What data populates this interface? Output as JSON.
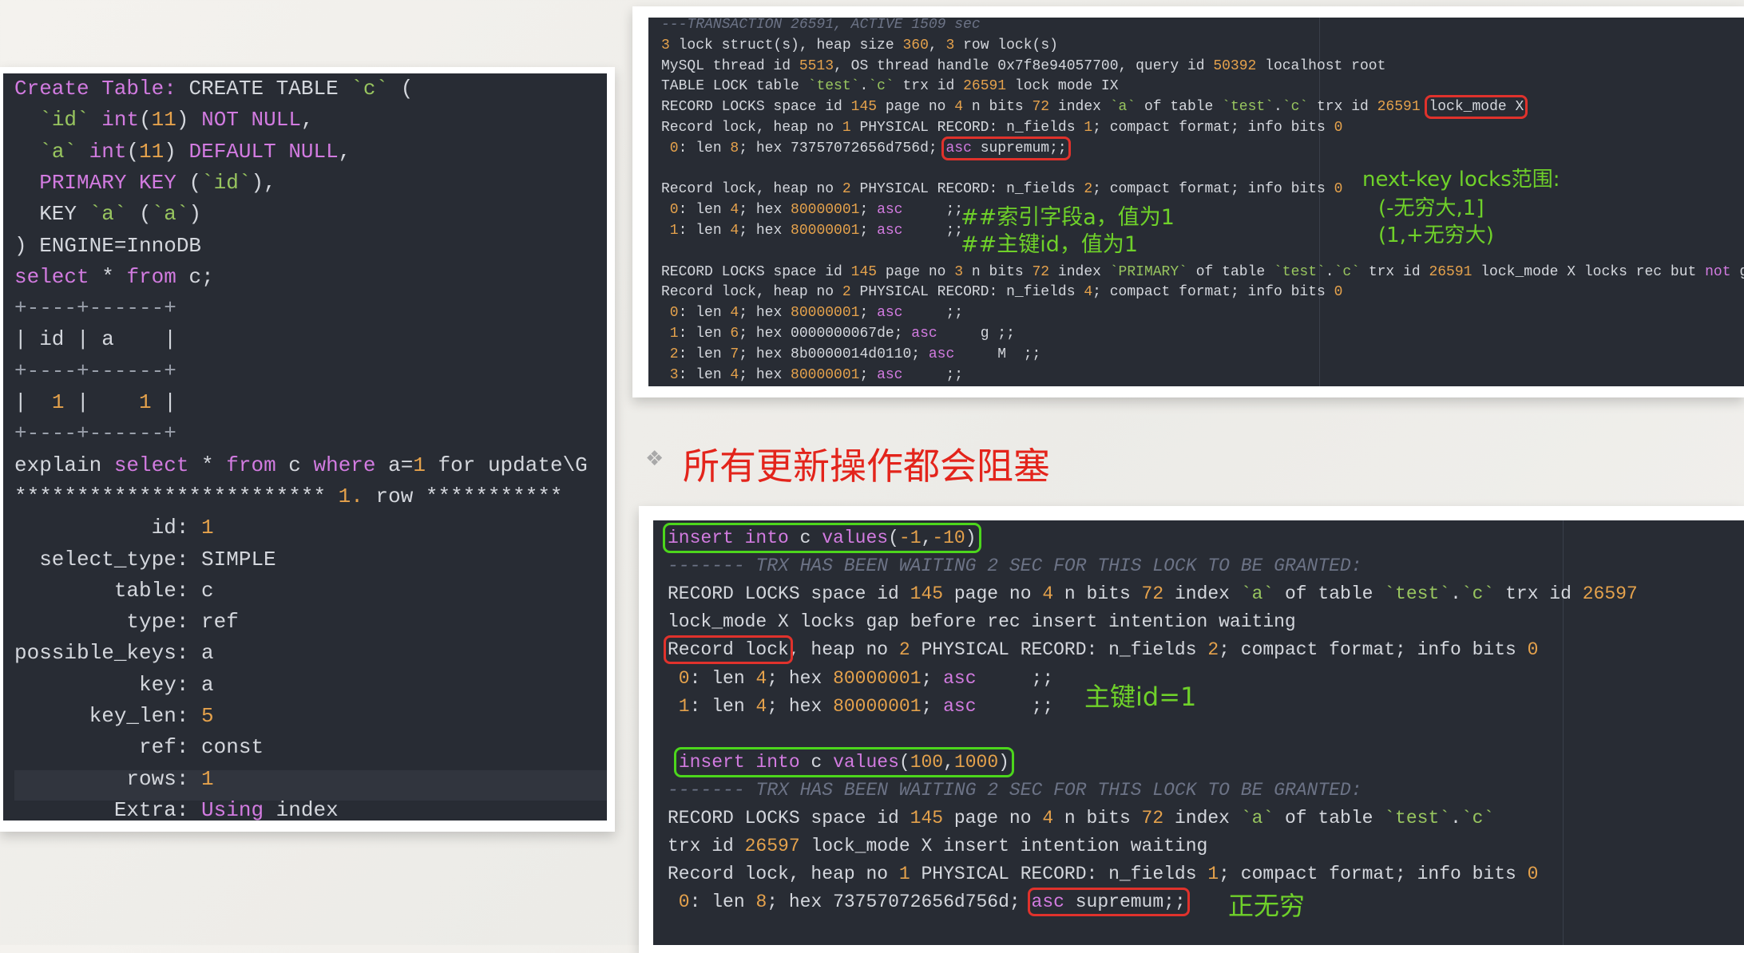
{
  "colors": {
    "keyword": "#d27be0",
    "number": "#e5a24c",
    "string": "#98c55f",
    "text": "#d4d7dd",
    "comment": "#6c7386",
    "highlight_red": "#e0322c",
    "highlight_green": "#4cd61c",
    "annotation": "#6fd12a",
    "title": "#e3241b",
    "terminal_bg": "#282c34"
  },
  "title": {
    "bullet_icon": "diamond-bullet-icon",
    "bullet": "❖",
    "text": "所有更新操作都会阻塞"
  },
  "left_panel": {
    "lines": [
      [
        [
          "Create Table:",
          "k"
        ],
        [
          " CREATE TABLE ",
          "w"
        ],
        [
          "`c`",
          "s"
        ],
        [
          " (",
          "w"
        ]
      ],
      [
        [
          "  ",
          "w"
        ],
        [
          "`id`",
          "s"
        ],
        [
          " ",
          "w"
        ],
        [
          "int",
          "k"
        ],
        [
          "(",
          "w"
        ],
        [
          "11",
          "n"
        ],
        [
          ") ",
          "w"
        ],
        [
          "NOT NULL",
          "k"
        ],
        [
          ",",
          "w"
        ]
      ],
      [
        [
          "  ",
          "w"
        ],
        [
          "`a`",
          "s"
        ],
        [
          " ",
          "w"
        ],
        [
          "int",
          "k"
        ],
        [
          "(",
          "w"
        ],
        [
          "11",
          "n"
        ],
        [
          ") ",
          "w"
        ],
        [
          "DEFAULT NULL",
          "k"
        ],
        [
          ",",
          "w"
        ]
      ],
      [
        [
          "  ",
          "w"
        ],
        [
          "PRIMARY KEY",
          "k"
        ],
        [
          " (",
          "w"
        ],
        [
          "`id`",
          "s"
        ],
        [
          "),",
          "w"
        ]
      ],
      [
        [
          "  KEY ",
          "w"
        ],
        [
          "`a`",
          "s"
        ],
        [
          " (",
          "w"
        ],
        [
          "`a`",
          "s"
        ],
        [
          ")",
          "w"
        ]
      ],
      [
        [
          ") ENGINE=InnoDB",
          "w"
        ]
      ],
      [
        [
          "select",
          "k"
        ],
        [
          " * ",
          "w"
        ],
        [
          "from",
          "k"
        ],
        [
          " c;",
          "w"
        ]
      ],
      [
        [
          "+----+------+",
          "d"
        ]
      ],
      [
        [
          "| id | a    |",
          "w"
        ]
      ],
      [
        [
          "+----+------+",
          "d"
        ]
      ],
      [
        [
          "|  ",
          "w"
        ],
        [
          "1",
          "n"
        ],
        [
          " |    ",
          "w"
        ],
        [
          "1",
          "n"
        ],
        [
          " |",
          "w"
        ]
      ],
      [
        [
          "+----+------+",
          "d"
        ]
      ],
      [
        [
          "explain ",
          "w"
        ],
        [
          "select",
          "k"
        ],
        [
          " * ",
          "w"
        ],
        [
          "from",
          "k"
        ],
        [
          " c ",
          "w"
        ],
        [
          "where",
          "k"
        ],
        [
          " a=",
          "w"
        ],
        [
          "1",
          "n"
        ],
        [
          " for update\\G",
          "w"
        ]
      ],
      [
        [
          "************************* ",
          "w"
        ],
        [
          "1.",
          "n"
        ],
        [
          " row ***********",
          "w"
        ]
      ],
      [
        [
          "           id: ",
          "w"
        ],
        [
          "1",
          "n"
        ]
      ],
      [
        [
          "  select_type: SIMPLE",
          "w"
        ]
      ],
      [
        [
          "        table: c",
          "w"
        ]
      ],
      [
        [
          "         type: ref",
          "w"
        ]
      ],
      [
        [
          "possible_keys: a",
          "w"
        ]
      ],
      [
        [
          "          key: a",
          "w"
        ]
      ],
      [
        [
          "      key_len: ",
          "w"
        ],
        [
          "5",
          "n"
        ]
      ],
      [
        [
          "          ref: const",
          "w"
        ]
      ],
      [
        [
          "         rows: ",
          "w"
        ],
        [
          "1",
          "n"
        ]
      ],
      [
        [
          "        Extra: ",
          "w"
        ],
        [
          "Using",
          "k"
        ],
        [
          " index",
          "w"
        ]
      ]
    ]
  },
  "top_right_panel": {
    "lines": [
      [
        [
          "---TRANSACTION 26591, ACTIVE 1509 sec",
          "c"
        ]
      ],
      [
        [
          "3",
          "n"
        ],
        [
          " lock struct(s), heap size ",
          "w"
        ],
        [
          "360",
          "n"
        ],
        [
          ", ",
          "w"
        ],
        [
          "3",
          "n"
        ],
        [
          " row lock(s)",
          "w"
        ]
      ],
      [
        [
          "MySQL thread id ",
          "w"
        ],
        [
          "5513",
          "n"
        ],
        [
          ", OS thread handle 0x7f8e94057700, query id ",
          "w"
        ],
        [
          "50392",
          "n"
        ],
        [
          " localhost root",
          "w"
        ]
      ],
      [
        [
          "TABLE LOCK table ",
          "w"
        ],
        [
          "`test`",
          "s"
        ],
        [
          ".",
          "w"
        ],
        [
          "`c`",
          "s"
        ],
        [
          " trx id ",
          "w"
        ],
        [
          "26591",
          "n"
        ],
        [
          " lock mode IX",
          "w"
        ]
      ],
      [
        [
          "RECORD LOCKS space id ",
          "w"
        ],
        [
          "145",
          "n"
        ],
        [
          " page no ",
          "w"
        ],
        [
          "4",
          "n"
        ],
        [
          " n bits ",
          "w"
        ],
        [
          "72",
          "n"
        ],
        [
          " index ",
          "w"
        ],
        [
          "`a`",
          "s"
        ],
        [
          " of table ",
          "w"
        ],
        [
          "`test`",
          "s"
        ],
        [
          ".",
          "w"
        ],
        [
          "`c`",
          "s"
        ],
        [
          " trx id ",
          "w"
        ],
        [
          "26591",
          "n"
        ],
        [
          " ",
          "w"
        ],
        {
          "box": "red",
          "t": [
            [
              "lock_mode X",
              "w"
            ]
          ]
        }
      ],
      [
        [
          "Record lock, heap no ",
          "w"
        ],
        [
          "1",
          "n"
        ],
        [
          " PHYSICAL RECORD: n_fields ",
          "w"
        ],
        [
          "1",
          "n"
        ],
        [
          "; compact format; info bits ",
          "w"
        ],
        [
          "0",
          "n"
        ]
      ],
      [
        [
          " 0",
          "n"
        ],
        [
          ": len ",
          "w"
        ],
        [
          "8",
          "n"
        ],
        [
          "; hex 73757072656d756d; ",
          "w"
        ],
        {
          "box": "red",
          "t": [
            [
              "asc",
              "k"
            ],
            [
              " supremum;;",
              "w"
            ]
          ]
        }
      ],
      [],
      [
        [
          "Record lock, heap no ",
          "w"
        ],
        [
          "2",
          "n"
        ],
        [
          " PHYSICAL RECORD: n_fields ",
          "w"
        ],
        [
          "2",
          "n"
        ],
        [
          "; compact format; info bits ",
          "w"
        ],
        [
          "0",
          "n"
        ]
      ],
      [
        [
          " 0",
          "n"
        ],
        [
          ": len ",
          "w"
        ],
        [
          "4",
          "n"
        ],
        [
          "; hex ",
          "w"
        ],
        [
          "80000001",
          "n"
        ],
        [
          "; ",
          "w"
        ],
        [
          "asc",
          "k"
        ],
        [
          "     ;;",
          "w"
        ]
      ],
      [
        [
          " 1",
          "n"
        ],
        [
          ": len ",
          "w"
        ],
        [
          "4",
          "n"
        ],
        [
          "; hex ",
          "w"
        ],
        [
          "80000001",
          "n"
        ],
        [
          "; ",
          "w"
        ],
        [
          "asc",
          "k"
        ],
        [
          "     ;;",
          "w"
        ]
      ],
      [],
      [
        [
          "RECORD LOCKS space id ",
          "w"
        ],
        [
          "145",
          "n"
        ],
        [
          " page no ",
          "w"
        ],
        [
          "3",
          "n"
        ],
        [
          " n bits ",
          "w"
        ],
        [
          "72",
          "n"
        ],
        [
          " index ",
          "w"
        ],
        [
          "`PRIMARY`",
          "s"
        ],
        [
          " of table ",
          "w"
        ],
        [
          "`test`",
          "s"
        ],
        [
          ".",
          "w"
        ],
        [
          "`c`",
          "s"
        ],
        [
          " trx id ",
          "w"
        ],
        [
          "26591",
          "n"
        ],
        [
          " lock_mode X locks rec but ",
          "w"
        ],
        [
          "not",
          "k"
        ],
        [
          " gap",
          "w"
        ]
      ],
      [
        [
          "Record lock, heap no ",
          "w"
        ],
        [
          "2",
          "n"
        ],
        [
          " PHYSICAL RECORD: n_fields ",
          "w"
        ],
        [
          "4",
          "n"
        ],
        [
          "; compact format; info bits ",
          "w"
        ],
        [
          "0",
          "n"
        ]
      ],
      [
        [
          " 0",
          "n"
        ],
        [
          ": len ",
          "w"
        ],
        [
          "4",
          "n"
        ],
        [
          "; hex ",
          "w"
        ],
        [
          "80000001",
          "n"
        ],
        [
          "; ",
          "w"
        ],
        [
          "asc",
          "k"
        ],
        [
          "     ;;",
          "w"
        ]
      ],
      [
        [
          " 1",
          "n"
        ],
        [
          ": len ",
          "w"
        ],
        [
          "6",
          "n"
        ],
        [
          "; hex 0000000067de; ",
          "w"
        ],
        [
          "asc",
          "k"
        ],
        [
          "     g ;;",
          "w"
        ]
      ],
      [
        [
          " 2",
          "n"
        ],
        [
          ": len ",
          "w"
        ],
        [
          "7",
          "n"
        ],
        [
          "; hex 8b0000014d0110; ",
          "w"
        ],
        [
          "asc",
          "k"
        ],
        [
          "     M  ;;",
          "w"
        ]
      ],
      [
        [
          " 3",
          "n"
        ],
        [
          ": len ",
          "w"
        ],
        [
          "4",
          "n"
        ],
        [
          "; hex ",
          "w"
        ],
        [
          "80000001",
          "n"
        ],
        [
          "; ",
          "w"
        ],
        [
          "asc",
          "k"
        ],
        [
          "     ;;",
          "w"
        ]
      ]
    ],
    "annotations": {
      "index_field": "##索引字段a，值为1",
      "primary_key": "##主键id，值为1",
      "range_title": "next-key locks范围:",
      "range_1": "(-无穷大,1]",
      "range_2": "(1,+无穷大)"
    }
  },
  "bottom_right_panel": {
    "lines": [
      [
        {
          "box": "green",
          "t": [
            [
              "insert into",
              "k"
            ],
            [
              " c ",
              "w"
            ],
            [
              "values",
              "k"
            ],
            [
              "(",
              "w"
            ],
            [
              "-1",
              "n"
            ],
            [
              ",",
              "w"
            ],
            [
              "-10",
              "n"
            ],
            [
              ")",
              "w"
            ]
          ]
        }
      ],
      [
        [
          "------- TRX HAS BEEN WAITING 2 SEC FOR THIS LOCK TO BE GRANTED:",
          "c"
        ]
      ],
      [
        [
          "RECORD LOCKS space id ",
          "w"
        ],
        [
          "145",
          "n"
        ],
        [
          " page no ",
          "w"
        ],
        [
          "4",
          "n"
        ],
        [
          " n bits ",
          "w"
        ],
        [
          "72",
          "n"
        ],
        [
          " index ",
          "w"
        ],
        [
          "`a`",
          "s"
        ],
        [
          " of table ",
          "w"
        ],
        [
          "`test`",
          "s"
        ],
        [
          ".",
          "w"
        ],
        [
          "`c`",
          "s"
        ],
        [
          " trx id ",
          "w"
        ],
        [
          "26597",
          "n"
        ]
      ],
      [
        [
          "lock_mode X locks gap before rec insert intention waiting",
          "w"
        ]
      ],
      [
        {
          "box": "red",
          "t": [
            [
              "Record lock",
              "w"
            ]
          ]
        },
        [
          ", heap no ",
          "w"
        ],
        [
          "2",
          "n"
        ],
        [
          " PHYSICAL RECORD: n_fields ",
          "w"
        ],
        [
          "2",
          "n"
        ],
        [
          "; compact format; info bits ",
          "w"
        ],
        [
          "0",
          "n"
        ]
      ],
      [
        [
          " 0",
          "n"
        ],
        [
          ": len ",
          "w"
        ],
        [
          "4",
          "n"
        ],
        [
          "; hex ",
          "w"
        ],
        [
          "80000001",
          "n"
        ],
        [
          "; ",
          "w"
        ],
        [
          "asc",
          "k"
        ],
        [
          "     ;;",
          "w"
        ]
      ],
      [
        [
          " 1",
          "n"
        ],
        [
          ": len ",
          "w"
        ],
        [
          "4",
          "n"
        ],
        [
          "; hex ",
          "w"
        ],
        [
          "80000001",
          "n"
        ],
        [
          "; ",
          "w"
        ],
        [
          "asc",
          "k"
        ],
        [
          "     ;;",
          "w"
        ]
      ],
      [],
      [
        [
          " ",
          "w"
        ],
        {
          "box": "green",
          "t": [
            [
              "insert into",
              "k"
            ],
            [
              " c ",
              "w"
            ],
            [
              "values",
              "k"
            ],
            [
              "(",
              "w"
            ],
            [
              "100",
              "n"
            ],
            [
              ",",
              "w"
            ],
            [
              "1000",
              "n"
            ],
            [
              ")",
              "w"
            ]
          ]
        }
      ],
      [
        [
          "------- TRX HAS BEEN WAITING 2 SEC FOR THIS LOCK TO BE GRANTED:",
          "c"
        ]
      ],
      [
        [
          "RECORD LOCKS space id ",
          "w"
        ],
        [
          "145",
          "n"
        ],
        [
          " page no ",
          "w"
        ],
        [
          "4",
          "n"
        ],
        [
          " n bits ",
          "w"
        ],
        [
          "72",
          "n"
        ],
        [
          " index ",
          "w"
        ],
        [
          "`a`",
          "s"
        ],
        [
          " of table ",
          "w"
        ],
        [
          "`test`",
          "s"
        ],
        [
          ".",
          "w"
        ],
        [
          "`c`",
          "s"
        ]
      ],
      [
        [
          "trx id ",
          "w"
        ],
        [
          "26597",
          "n"
        ],
        [
          " lock_mode X insert intention waiting",
          "w"
        ]
      ],
      [
        [
          "Record lock, heap no ",
          "w"
        ],
        [
          "1",
          "n"
        ],
        [
          " PHYSICAL RECORD: n_fields ",
          "w"
        ],
        [
          "1",
          "n"
        ],
        [
          "; compact format; info bits ",
          "w"
        ],
        [
          "0",
          "n"
        ]
      ],
      [
        [
          " 0",
          "n"
        ],
        [
          ": len ",
          "w"
        ],
        [
          "8",
          "n"
        ],
        [
          "; hex 73757072656d756d; ",
          "w"
        ],
        {
          "box": "red",
          "t": [
            [
              "asc",
              "k"
            ],
            [
              " supremum;;",
              "w"
            ]
          ]
        }
      ]
    ],
    "annotations": {
      "primary_key": "主键id=1",
      "positive_infinity": "正无穷"
    }
  }
}
